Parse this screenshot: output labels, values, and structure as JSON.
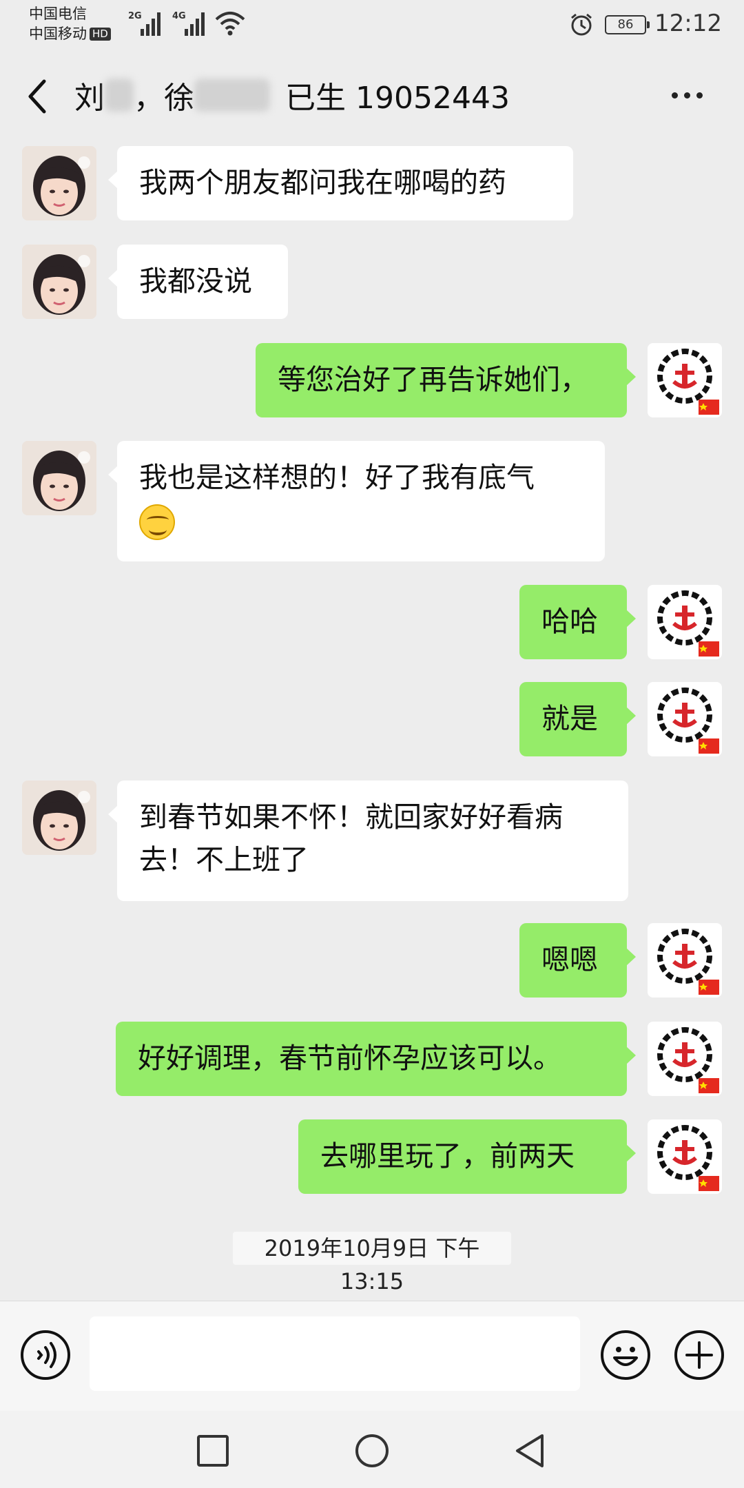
{
  "status_bar": {
    "carrier1": "中国电信",
    "carrier2": "中国移动",
    "hd": "HD",
    "net1": "2G",
    "net2": "4G",
    "battery": "86",
    "time": "12:12"
  },
  "header": {
    "name1": "刘",
    "sep": "，",
    "name2": "徐",
    "suffix": "已生 19052443"
  },
  "messages": [
    {
      "side": "left",
      "text": "我两个朋友都问我在哪喝的药"
    },
    {
      "side": "left",
      "text": "我都没说"
    },
    {
      "side": "right",
      "text": "等您治好了再告诉她们，"
    },
    {
      "side": "left",
      "line1": "我也是这样想的！好了我有底气",
      "emoji": "smiling-face"
    },
    {
      "side": "right",
      "text": "哈哈"
    },
    {
      "side": "right",
      "text": "就是"
    },
    {
      "side": "left",
      "line1": "到春节如果不怀！就回家好好看病",
      "line2": "去！不上班了"
    },
    {
      "side": "right",
      "text": "嗯嗯"
    },
    {
      "side": "right",
      "text": "好好调理，春节前怀孕应该可以。"
    },
    {
      "side": "right",
      "text": "去哪里玩了，前两天"
    }
  ],
  "timestamp": "2019年10月9日 下午13:15",
  "input": {
    "value": ""
  },
  "colors": {
    "sent_bubble": "#95ec69",
    "received_bubble": "#ffffff",
    "background": "#ededed"
  }
}
